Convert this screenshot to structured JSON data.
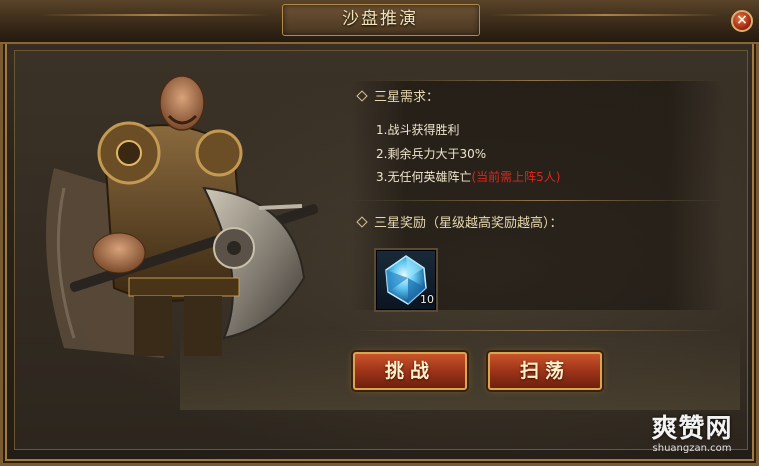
{
  "window": {
    "title": "沙盘推演",
    "close_glyph": "×"
  },
  "conditions": {
    "heading": "三星需求：",
    "items": [
      {
        "text": "1.战斗获得胜利",
        "note": ""
      },
      {
        "text": "2.剩余兵力大于30%",
        "note": ""
      },
      {
        "text": "3.无任何英雄阵亡",
        "note": "(当前需上阵5人)"
      }
    ]
  },
  "rewards": {
    "heading": "三星奖励（星级越高奖励越高）：",
    "items": [
      {
        "icon": "blue-crystal-icon",
        "count": "10"
      }
    ]
  },
  "buttons": {
    "challenge_label": "挑战",
    "sweep_label": "扫荡"
  },
  "watermark": {
    "main": "爽赞网",
    "sub": "shuangzan.com"
  },
  "colors": {
    "frame_gold": "#a07a3e",
    "note_red": "#e0251a",
    "button_red": "#a2361a",
    "text_light": "#f0e6cc"
  }
}
